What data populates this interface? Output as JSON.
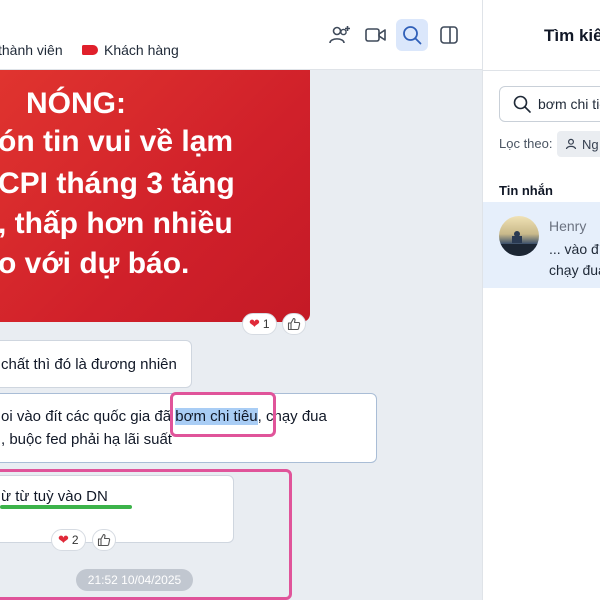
{
  "header": {
    "tags": [
      {
        "label": "thành viên"
      },
      {
        "label": "Khách hàng"
      }
    ]
  },
  "news_image": {
    "lines": [
      "NÓNG:",
      "ón tin vui về lạm",
      "CPI tháng 3 tăng",
      ", thấp hơn nhiều",
      "o với dự báo."
    ],
    "reaction_count": "1"
  },
  "messages": [
    {
      "lines": [
        "chất thì đó là đương nhiên"
      ]
    },
    {
      "line1_before": "oi vào đít các quốc gia đã ",
      "line1_highlight": "bơm chi tiêu",
      "line1_after": ", chạy đua",
      "line2": ", buộc fed phải hạ lãi suất"
    },
    {
      "lines": [
        "ừ từ tuỳ vào DN"
      ],
      "reaction_count": "2"
    }
  ],
  "timestamp": "21:52 10/04/2025",
  "search_panel": {
    "title": "Tìm kiế",
    "query": "bơm chi tiê",
    "filter_label": "Lọc theo:",
    "filter_chip": "Ng",
    "section_label": "Tin nhắn",
    "result": {
      "sender": "Henry",
      "line1": "... vào đí",
      "line2": "chạy đua"
    }
  },
  "colors": {
    "accent": "#3b6fd8",
    "tag_red": "#e0202b",
    "highlight_box": "#e0549a",
    "underline_green": "#3cb34a"
  }
}
